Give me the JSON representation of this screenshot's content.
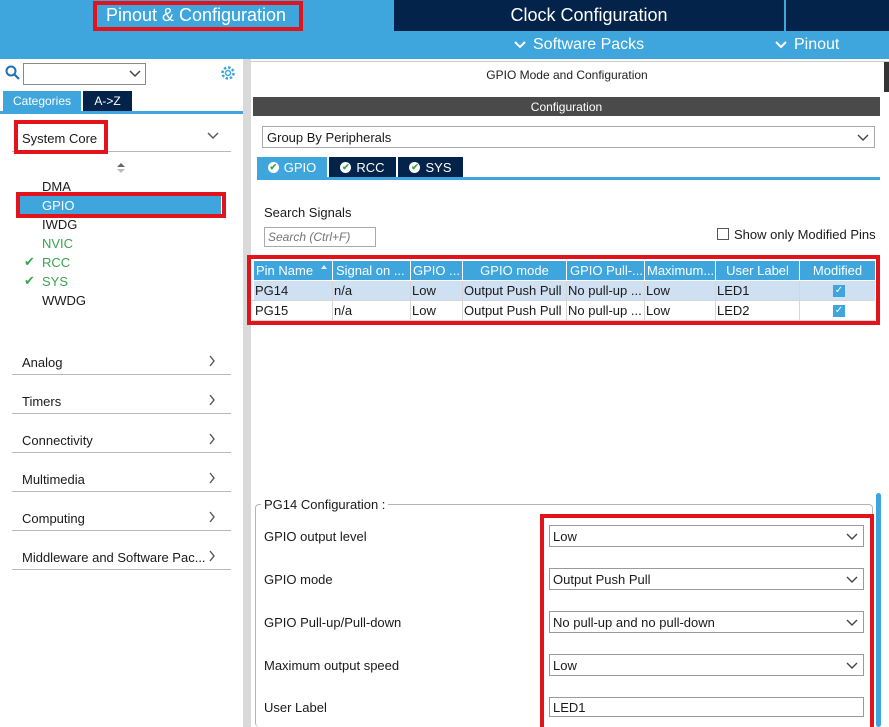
{
  "header": {
    "tab_pinout": "Pinout & Configuration",
    "tab_clock": "Clock Configuration",
    "software_packs": "Software Packs",
    "pinout_menu": "Pinout",
    "chevron": "⌄"
  },
  "sidebar": {
    "search_value": "",
    "tab_categories": "Categories",
    "tab_atoz": "A->Z",
    "system_core": "System Core",
    "items": [
      {
        "label": "DMA",
        "state": "none"
      },
      {
        "label": "GPIO",
        "state": "selected"
      },
      {
        "label": "IWDG",
        "state": "none"
      },
      {
        "label": "NVIC",
        "state": "green"
      },
      {
        "label": "RCC",
        "state": "checked"
      },
      {
        "label": "SYS",
        "state": "checked"
      },
      {
        "label": "WWDG",
        "state": "none"
      }
    ],
    "sections": [
      "Analog",
      "Timers",
      "Connectivity",
      "Multimedia",
      "Computing",
      "Middleware and Software Pac..."
    ]
  },
  "main": {
    "title": "GPIO Mode and Configuration",
    "config_bar": "Configuration",
    "group_by": "Group By Peripherals",
    "tabs": [
      "GPIO",
      "RCC",
      "SYS"
    ],
    "search_label": "Search Signals",
    "search_placeholder": "Search (Ctrl+F)",
    "show_modified": "Show only Modified Pins",
    "table": {
      "headers": [
        "Pin Name",
        "Signal on ...",
        "GPIO ...",
        "GPIO mode",
        "GPIO Pull-...",
        "Maximum...",
        "User Label",
        "Modified"
      ],
      "rows": [
        [
          "PG14",
          "n/a",
          "Low",
          "Output Push Pull",
          "No pull-up ...",
          "Low",
          "LED1",
          "✓"
        ],
        [
          "PG15",
          "n/a",
          "Low",
          "Output Push Pull",
          "No pull-up ...",
          "Low",
          "LED2",
          "✓"
        ]
      ]
    },
    "pin_config": {
      "legend": "PG14 Configuration :",
      "fields": [
        {
          "label": "GPIO output level",
          "value": "Low"
        },
        {
          "label": "GPIO mode",
          "value": "Output Push Pull"
        },
        {
          "label": "GPIO Pull-up/Pull-down",
          "value": "No pull-up and no pull-down"
        },
        {
          "label": "Maximum output speed",
          "value": "Low"
        },
        {
          "label": "User Label",
          "value": "LED1"
        }
      ]
    }
  },
  "colors": {
    "accent": "#3ea6dc",
    "dark_navy": "#03234b",
    "highlight": "#e3131b",
    "check_green": "#3aa44e"
  }
}
